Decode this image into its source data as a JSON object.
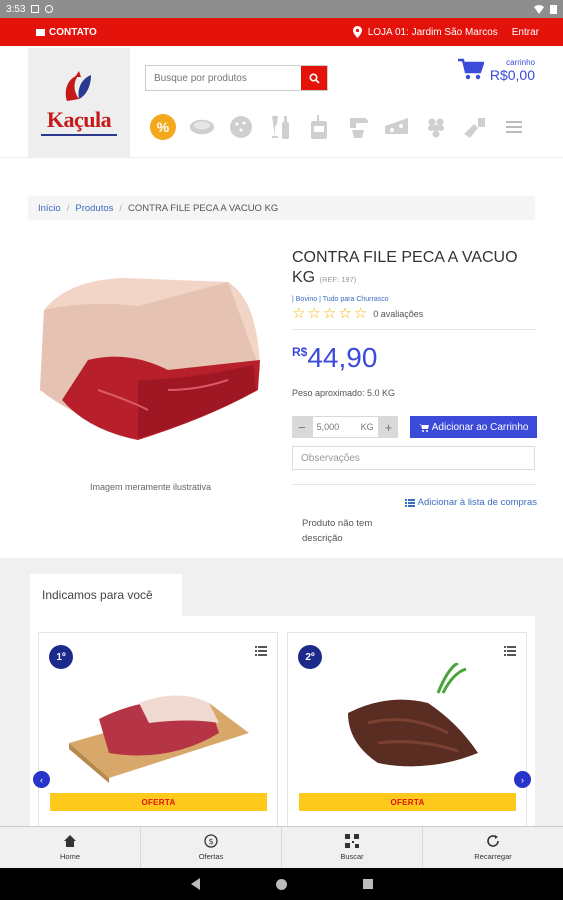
{
  "status_bar": {
    "time": "3:53"
  },
  "topbar": {
    "contact": "CONTATO",
    "store": "LOJA 01: Jardim São Marcos",
    "login": "Entrar"
  },
  "brand": {
    "name": "Kaçula",
    "primary_color": "#e3120b",
    "accent_color": "#3b4ad9"
  },
  "search": {
    "placeholder": "Busque por produtos"
  },
  "cart": {
    "label": "carrinho",
    "total": "R$0,00"
  },
  "categories": [
    "percent-icon",
    "meat-icon",
    "cookie-icon",
    "wine-icon",
    "drink-icon",
    "mixer-icon",
    "cheese-icon",
    "grapes-icon",
    "cleaning-icon",
    "menu-icon"
  ],
  "breadcrumb": {
    "home": "Início",
    "products": "Produtos",
    "current": "CONTRA FILE PECA A VACUO KG"
  },
  "product": {
    "title": "CONTRA FILE PECA A VACUO KG",
    "ref": "(REF: 197)",
    "categories": "| Bovino | Tudo para Churrasco",
    "stars": 0,
    "reviews": "0 avaliações",
    "currency": "R$",
    "price": "44,90",
    "weight": "Peso aproximado: 5.0 KG",
    "quantity": "5,000",
    "unit": "KG",
    "add_to_cart": "Adicionar ao Carrinho",
    "notes_placeholder": "Observações",
    "add_to_list": "Adicionar à lista de compras",
    "no_description": "Produto não tem descrição",
    "image_caption": "Imagem meramente ilustrativa"
  },
  "recommendations": {
    "title": "Indicamos para você",
    "items": [
      {
        "rank": "1º",
        "badge": "OFERTA"
      },
      {
        "rank": "2º",
        "badge": "OFERTA"
      }
    ]
  },
  "bottom_nav": {
    "home": "Home",
    "offers": "Ofertas",
    "search": "Buscar",
    "reload": "Recarregar"
  }
}
